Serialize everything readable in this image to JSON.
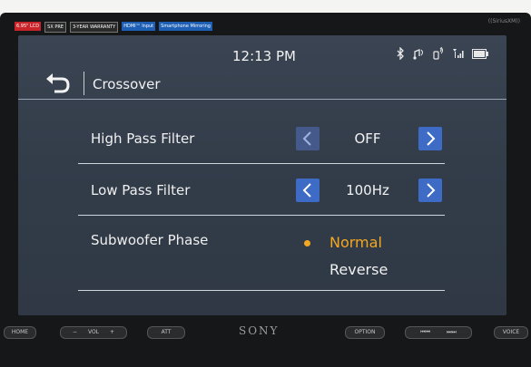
{
  "stickers": {
    "lcd": "6.95\" LCD",
    "sxm": "SX PRE",
    "warranty": "3-YEAR WARRANTY",
    "hdmi": "HDMI™ Input",
    "mirroring": "Smartphone Mirroring"
  },
  "brand_top": "((SiriusXM))",
  "status_bar": {
    "time": "12:13 PM"
  },
  "header": {
    "title": "Crossover"
  },
  "settings": {
    "hpf": {
      "label": "High Pass Filter",
      "value": "OFF"
    },
    "lpf": {
      "label": "Low Pass Filter",
      "value": "100Hz"
    },
    "phase": {
      "label": "Subwoofer Phase",
      "options": [
        "Normal",
        "Reverse"
      ],
      "selected": "Normal"
    }
  },
  "hardware_buttons": {
    "home": "HOME",
    "vol_minus": "−",
    "vol": "VOL",
    "vol_plus": "+",
    "att": "ATT",
    "option": "OPTION",
    "prev": "⏮⏮",
    "next": "⏭⏭",
    "voice": "VOICE"
  },
  "brand": "SONY",
  "colors": {
    "accent": "#f4a821",
    "button_blue": "#3d6bc6",
    "screen_bg": "#333d4a"
  }
}
